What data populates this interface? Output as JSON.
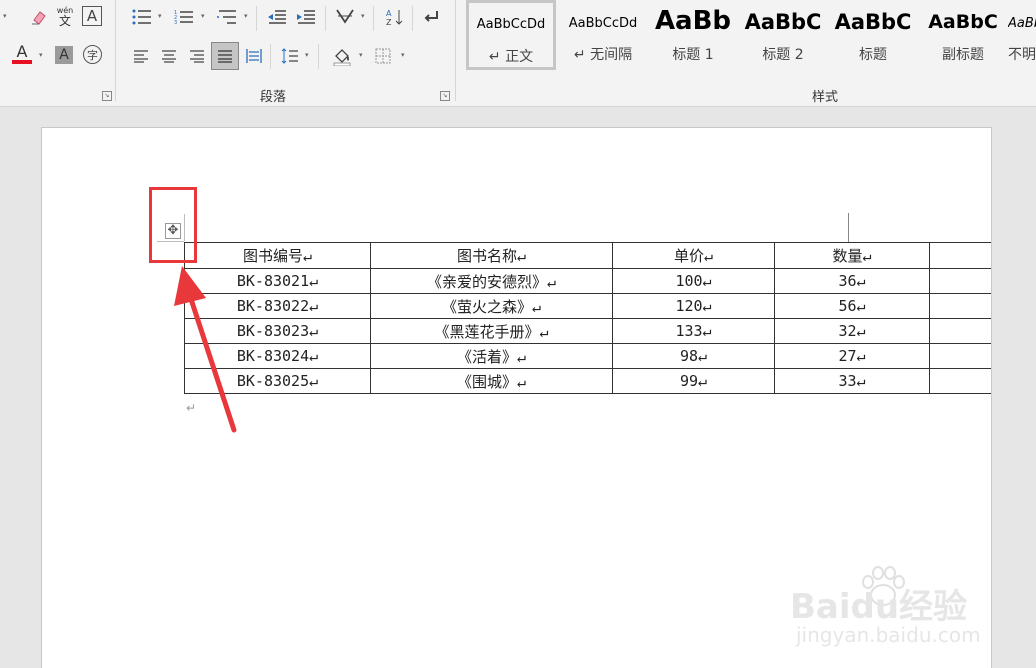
{
  "ribbon": {
    "paragraph_group_label": "段落",
    "styles_group_label": "样式",
    "font": {
      "phonetic_top": "wén",
      "phonetic_bottom": "文",
      "border_char_glyph": "A",
      "font_color_glyph": "A",
      "font_color": "#e81123",
      "shading_glyph": "A",
      "enclose_glyph": "字"
    },
    "styles": [
      {
        "preview": "AaBbCcDd",
        "label": "↵ 正文"
      },
      {
        "preview": "AaBbCcDd",
        "label": "↵ 无间隔"
      },
      {
        "preview": "AaBb",
        "label": "标题 1"
      },
      {
        "preview": "AaBbC",
        "label": "标题 2"
      },
      {
        "preview": "AaBbC",
        "label": "标题"
      },
      {
        "preview": "AaBbC",
        "label": "副标题"
      },
      {
        "preview": "AaBbCcD",
        "label": "不明"
      }
    ]
  },
  "document": {
    "table": {
      "headers": [
        "图书编号↵",
        "图书名称↵",
        "单价↵",
        "数量↵",
        ""
      ],
      "rows": [
        [
          "BK-83021↵",
          "《亲爱的安德烈》↵",
          "100↵",
          "36↵",
          ""
        ],
        [
          "BK-83022↵",
          "《萤火之森》↵",
          "120↵",
          "56↵",
          ""
        ],
        [
          "BK-83023↵",
          "《黑莲花手册》↵",
          "133↵",
          "32↵",
          ""
        ],
        [
          "BK-83024↵",
          "《活着》↵",
          "98↵",
          "27↵",
          ""
        ],
        [
          "BK-83025↵",
          "《围城》↵",
          "99↵",
          "33↵",
          ""
        ]
      ]
    },
    "after_table_mark": "↵",
    "move_handle_glyph": "✥"
  },
  "annotation": {
    "color": "#e8383b"
  },
  "watermark": {
    "brand": "Baidu经验",
    "url": "jingyan.baidu.com"
  }
}
